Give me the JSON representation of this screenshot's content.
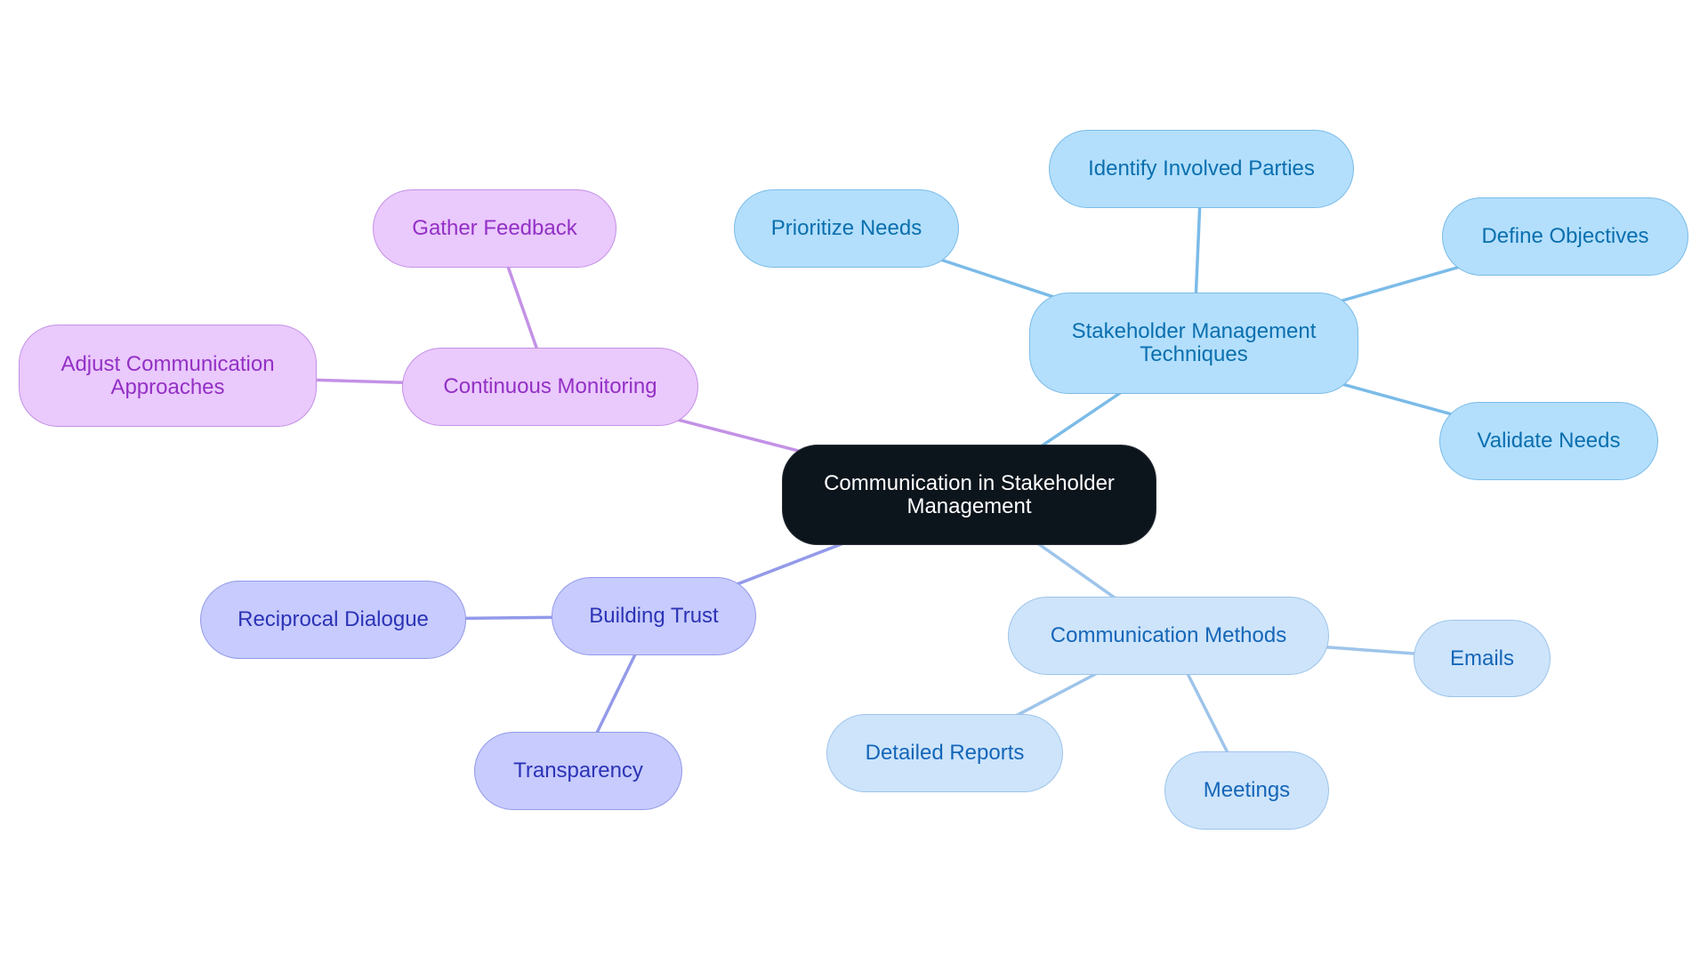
{
  "diagram": {
    "type": "mind-map",
    "colors": {
      "root_fill": "#0c141c",
      "blue_branch": "#7bbbe8",
      "purple_branch": "#c391e6",
      "indigo_branch": "#939ae9",
      "lightblue_branch": "#9ec4ea"
    },
    "root": {
      "label": "Communication in Stakeholder\nManagement"
    },
    "branches": [
      {
        "id": "techniques",
        "label": "Stakeholder Management\nTechniques",
        "theme": "blue",
        "children": [
          {
            "id": "identify",
            "label": "Identify Involved Parties"
          },
          {
            "id": "prioritize",
            "label": "Prioritize Needs"
          },
          {
            "id": "define",
            "label": "Define Objectives"
          },
          {
            "id": "validate",
            "label": "Validate Needs"
          }
        ]
      },
      {
        "id": "monitoring",
        "label": "Continuous Monitoring",
        "theme": "purple",
        "children": [
          {
            "id": "feedback",
            "label": "Gather Feedback"
          },
          {
            "id": "adjust",
            "label": "Adjust Communication\nApproaches"
          }
        ]
      },
      {
        "id": "trust",
        "label": "Building Trust",
        "theme": "indigo",
        "children": [
          {
            "id": "dialogue",
            "label": "Reciprocal Dialogue"
          },
          {
            "id": "transparency",
            "label": "Transparency"
          }
        ]
      },
      {
        "id": "methods",
        "label": "Communication Methods",
        "theme": "lightblue",
        "children": [
          {
            "id": "emails",
            "label": "Emails"
          },
          {
            "id": "reports",
            "label": "Detailed Reports"
          },
          {
            "id": "meetings",
            "label": "Meetings"
          }
        ]
      }
    ]
  }
}
